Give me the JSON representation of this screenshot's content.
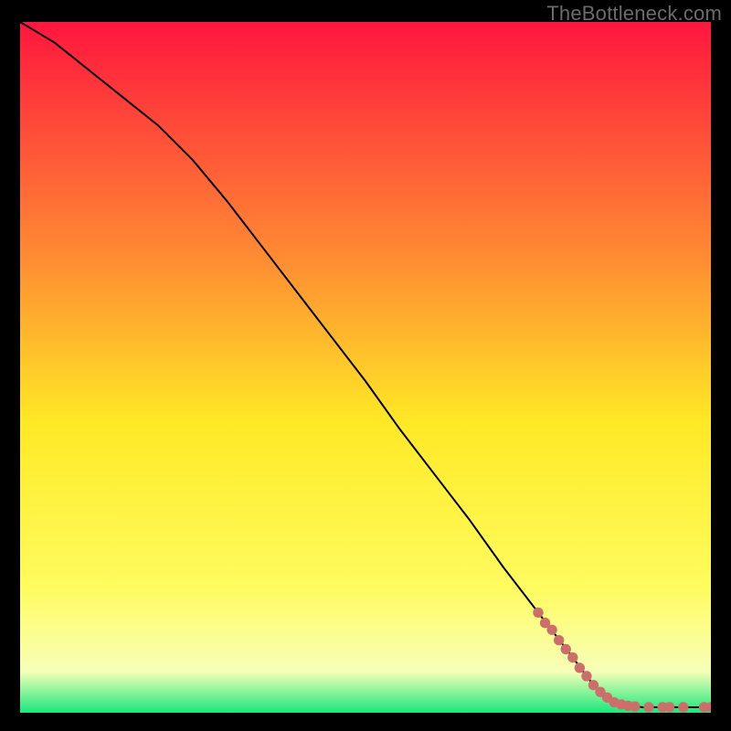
{
  "watermark": "TheBottleneck.com",
  "colors": {
    "background": "#000000",
    "line": "#000000",
    "marker": "#cc6f6a",
    "grad_top": "#ff163e",
    "grad_mid_upper": "#ff8b33",
    "grad_mid": "#ffe925",
    "grad_mid_lower": "#fffc60",
    "grad_lower": "#f7ffb8",
    "grad_bottom": "#19e87b"
  },
  "chart_data": {
    "type": "line",
    "title": "",
    "xlabel": "",
    "ylabel": "",
    "xlim": [
      0,
      100
    ],
    "ylim": [
      0,
      100
    ],
    "series": [
      {
        "name": "curve",
        "x": [
          0,
          5,
          10,
          15,
          20,
          25,
          30,
          35,
          40,
          45,
          50,
          55,
          60,
          65,
          70,
          75,
          80,
          83,
          86,
          90,
          95,
          100
        ],
        "y": [
          100,
          97,
          93,
          89,
          85,
          80,
          74,
          67.5,
          61,
          54.5,
          48,
          41,
          34.5,
          28,
          21,
          14.5,
          8,
          4,
          1.5,
          0.8,
          0.8,
          0.8
        ]
      }
    ],
    "markers": {
      "name": "highlight-dots",
      "x": [
        75,
        76,
        77,
        78,
        79,
        80,
        81,
        82,
        83,
        84,
        85,
        86,
        87,
        88,
        89,
        91,
        93,
        94,
        96,
        99,
        100
      ],
      "y": [
        14.5,
        13,
        12,
        10.5,
        9.2,
        8,
        6.5,
        5.3,
        4,
        3,
        2.2,
        1.5,
        1.2,
        1.0,
        0.9,
        0.8,
        0.8,
        0.8,
        0.8,
        0.8,
        0.8
      ]
    }
  }
}
